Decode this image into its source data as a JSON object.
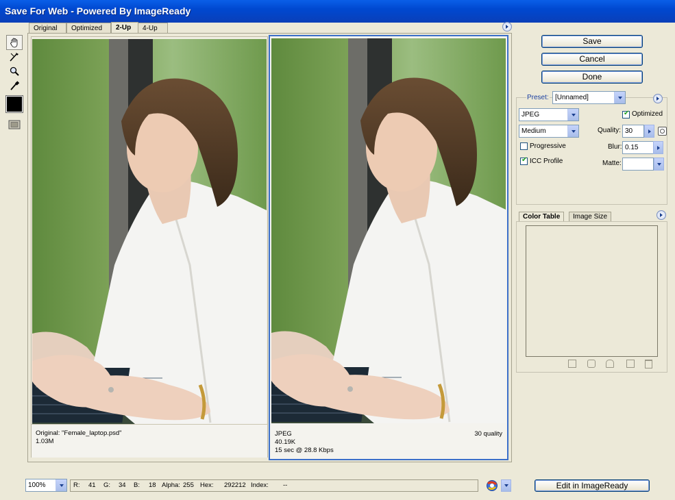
{
  "window": {
    "title": "Save For Web - Powered By ImageReady"
  },
  "tabs": [
    {
      "label": "Original"
    },
    {
      "label": "Optimized"
    },
    {
      "label": "2-Up"
    },
    {
      "label": "4-Up"
    }
  ],
  "tools": [
    "hand-tool-icon",
    "slice-select-tool-icon",
    "zoom-tool-icon",
    "eyedropper-tool-icon",
    "color-swatch",
    "preview-toggle-icon"
  ],
  "left_pane": {
    "line1": "Original: \"Female_laptop.psd\"",
    "line2": "1.03M"
  },
  "right_pane": {
    "format": "JPEG",
    "size": "40.19K",
    "time": "15 sec @ 28.8 Kbps",
    "quality": "30 quality"
  },
  "buttons": {
    "save": "Save",
    "cancel": "Cancel",
    "done": "Done",
    "edit": "Edit in ImageReady"
  },
  "settings": {
    "preset_label": "Preset:",
    "preset_value": "[Unnamed]",
    "format": "JPEG",
    "optimized_label": "Optimized",
    "quality_preset": "Medium",
    "quality_label": "Quality:",
    "quality_value": "30",
    "progressive_label": "Progressive",
    "blur_label": "Blur:",
    "blur_value": "0.15",
    "icc_label": "ICC Profile",
    "matte_label": "Matte:",
    "optimized_checked": true,
    "progressive_checked": false,
    "icc_checked": true
  },
  "bottom_tabs": [
    {
      "label": "Color Table"
    },
    {
      "label": "Image Size"
    }
  ],
  "status": {
    "zoom": "100%",
    "r_label": "R:",
    "r_value": "41",
    "g_label": "G:",
    "g_value": "34",
    "b_label": "B:",
    "b_value": "18",
    "alpha_label": "Alpha:",
    "alpha_value": "255",
    "hex_label": "Hex:",
    "hex_value": "292212",
    "index_label": "Index:",
    "index_value": "--"
  },
  "colors": {
    "title_bar": "#0a5fe8",
    "selection_border": "#3b6fc9",
    "face": "#ece9d8"
  }
}
